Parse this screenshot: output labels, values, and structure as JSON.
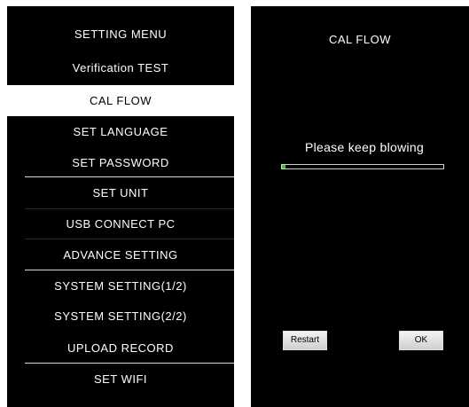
{
  "menu": {
    "title": "SETTING MENU",
    "items": [
      {
        "label": "Verification TEST"
      },
      {
        "label": "CAL FLOW"
      },
      {
        "label": "SET LANGUAGE"
      },
      {
        "label": "SET PASSWORD"
      },
      {
        "label": "SET UNIT"
      },
      {
        "label": "USB CONNECT PC"
      },
      {
        "label": "ADVANCE SETTING"
      },
      {
        "label": "SYSTEM SETTING(1/2)"
      },
      {
        "label": "SYSTEM SETTING(2/2)"
      },
      {
        "label": "UPLOAD RECORD"
      },
      {
        "label": "SET WIFI"
      }
    ],
    "selected_label": "CAL FLOW"
  },
  "cal_flow": {
    "title": "CAL FLOW",
    "message": "Please keep blowing",
    "progress_fraction": 0.02,
    "restart_label": "Restart",
    "ok_label": "OK"
  },
  "colors": {
    "panel_background": "#000000",
    "selected_background": "#ffffff",
    "progress_fill": "#2fcc2f"
  }
}
